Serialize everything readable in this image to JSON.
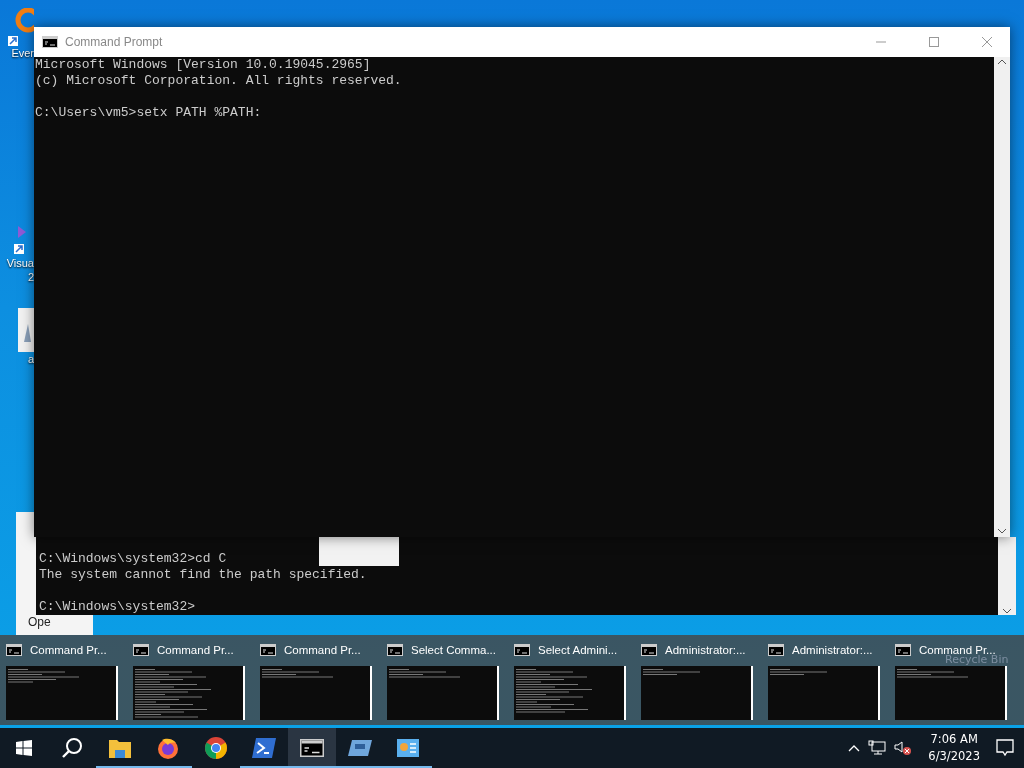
{
  "desktop_icons": [
    {
      "kind": "app",
      "label": "Ever"
    },
    {
      "kind": "vs",
      "label": "Visua",
      "label_2": "2"
    },
    {
      "kind": "file",
      "label": "a"
    }
  ],
  "back_window": {
    "label": "Ope",
    "lines": [
      {
        "text": "C:\\Windows\\system32>cd C",
        "gap_before": false
      },
      {
        "text": "The system cannot find the path specified.",
        "gap_before": false
      },
      {
        "text": "C:\\Windows\\system32>",
        "gap_before": true
      }
    ]
  },
  "window": {
    "title": "Command Prompt",
    "lines": [
      {
        "text": "Microsoft Windows [Version 10.0.19045.2965]",
        "gap_before": false
      },
      {
        "text": "(c) Microsoft Corporation. All rights reserved.",
        "gap_before": false
      },
      {
        "text": "C:\\Users\\vm5>setx PATH %PATH:",
        "gap_before": true
      }
    ]
  },
  "task_switcher": [
    {
      "title": "Command Pr..."
    },
    {
      "title": "Command Pr..."
    },
    {
      "title": "Command Pr..."
    },
    {
      "title": "Select Comma..."
    },
    {
      "title": "Select Admini..."
    },
    {
      "title": "Administrator:..."
    },
    {
      "title": "Administrator:..."
    },
    {
      "title": "Command Pr..."
    }
  ],
  "recycle_label": "Recycle Bin",
  "taskbar": {
    "apps": [
      {
        "kind": "start",
        "running": false,
        "selected": false
      },
      {
        "kind": "search",
        "running": false,
        "selected": false
      },
      {
        "kind": "explorer",
        "running": true,
        "selected": false
      },
      {
        "kind": "firefox",
        "running": true,
        "selected": false
      },
      {
        "kind": "chrome",
        "running": false,
        "selected": false
      },
      {
        "kind": "powershell",
        "running": true,
        "selected": false
      },
      {
        "kind": "cmd",
        "running": true,
        "selected": true
      },
      {
        "kind": "remote",
        "running": true,
        "selected": false
      },
      {
        "kind": "panel",
        "running": true,
        "selected": false
      }
    ],
    "time": "7:06 AM",
    "date": "6/3/2023"
  }
}
